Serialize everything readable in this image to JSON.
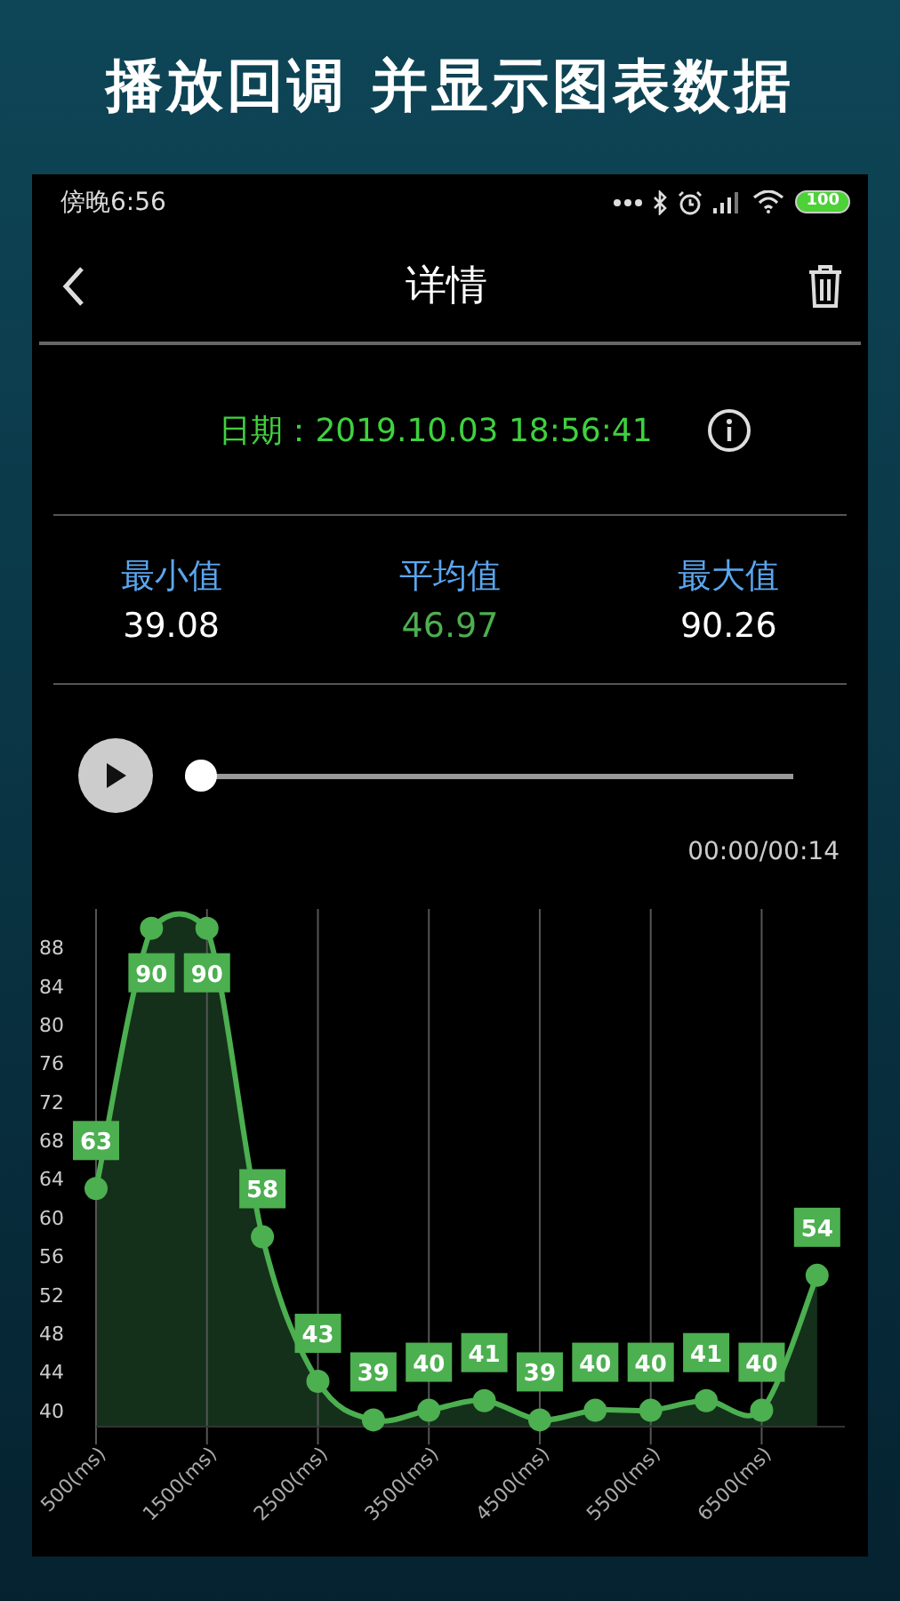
{
  "banner": {
    "title": "播放回调 并显示图表数据"
  },
  "status_bar": {
    "time": "傍晚6:56",
    "battery": "100"
  },
  "header": {
    "title": "详情"
  },
  "record": {
    "date": "日期：2019.10.03 18:56:41"
  },
  "stats": [
    {
      "label": "最小值",
      "value": "39.08",
      "kind": "normal"
    },
    {
      "label": "平均值",
      "value": "46.97",
      "kind": "average"
    },
    {
      "label": "最大值",
      "value": "90.26",
      "kind": "normal"
    }
  ],
  "player": {
    "level": 0,
    "time": "00:00/00:14"
  },
  "chart": {
    "chart_data": {
      "type": "area",
      "x": [
        500,
        1000,
        1500,
        2000,
        2500,
        3000,
        3500,
        4000,
        4500,
        5000,
        5500,
        6000,
        6500,
        7000
      ],
      "grid": true,
      "series": [
        {
          "color": "#4caf50",
          "values": [
            63,
            90,
            90,
            58,
            43,
            39,
            40,
            41,
            39,
            40,
            40,
            41,
            40,
            54
          ]
        }
      ],
      "xlim": [
        500,
        7250
      ],
      "ylim": [
        38.3,
        92
      ],
      "xticks": [
        {
          "value": 500,
          "label": "500(ms)"
        },
        {
          "value": 1500,
          "label": "1500(ms)"
        },
        {
          "value": 2500,
          "label": "2500(ms)"
        },
        {
          "value": 3500,
          "label": "3500(ms)"
        },
        {
          "value": 4500,
          "label": "4500(ms)"
        },
        {
          "value": 5500,
          "label": "5500(ms)"
        },
        {
          "value": 6500,
          "label": "6500(ms)"
        }
      ],
      "yticks": [
        40,
        44,
        48,
        52,
        56,
        60,
        64,
        68,
        72,
        76,
        80,
        84,
        88
      ],
      "data_labels": true
    }
  }
}
